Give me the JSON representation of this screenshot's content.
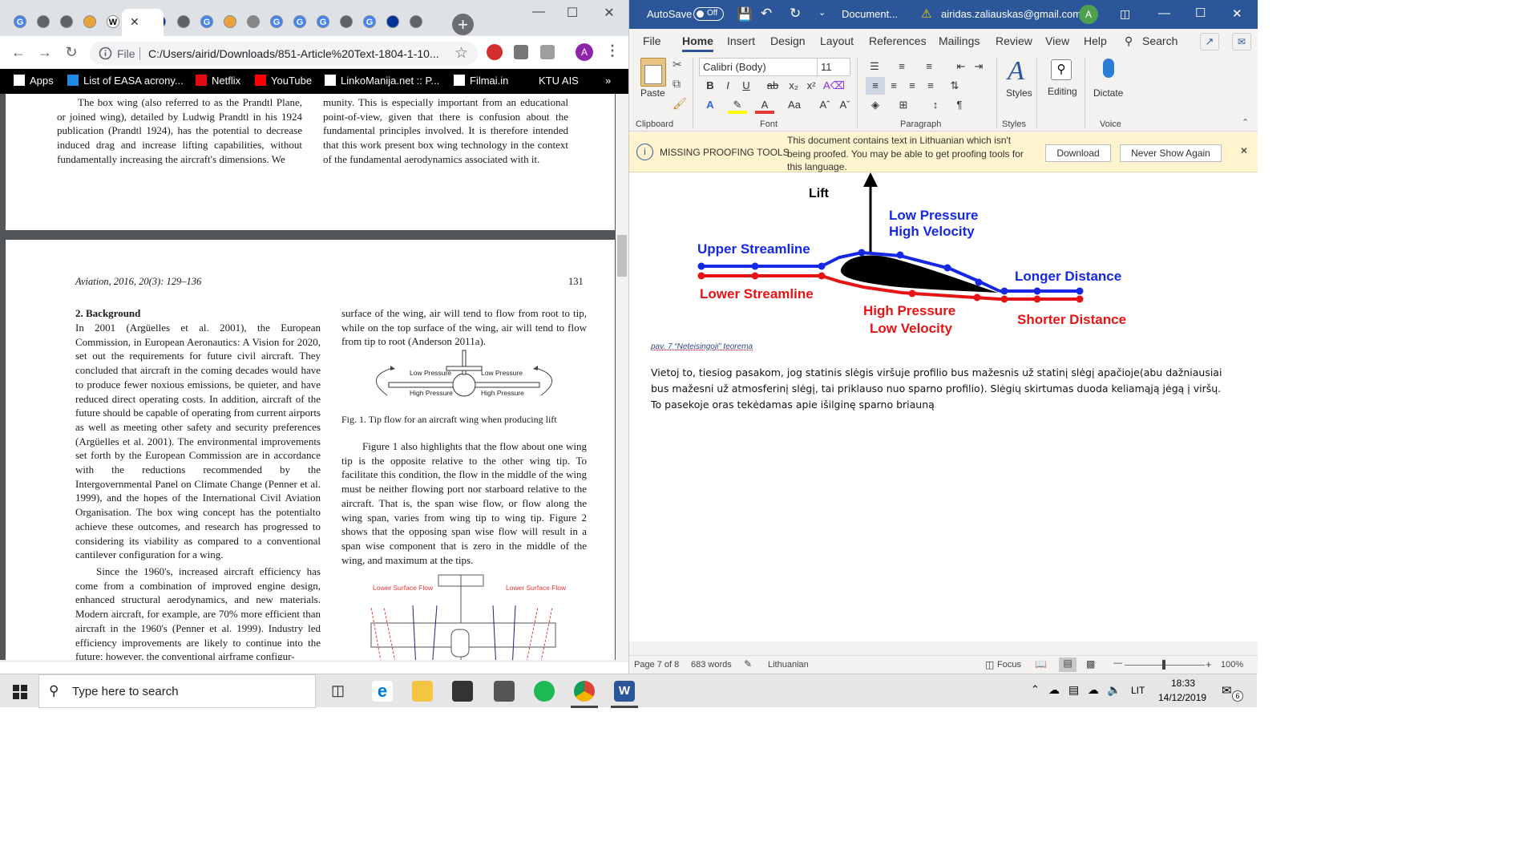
{
  "chrome": {
    "tabs": [
      {
        "icon": "google-icon",
        "color": "#4285f4",
        "glyph": "G"
      },
      {
        "icon": "globe-icon",
        "color": "#5f6368",
        "glyph": ""
      },
      {
        "icon": "globe-icon",
        "color": "#5f6368",
        "glyph": ""
      },
      {
        "icon": "scholar-bars-icon",
        "color": "#e8a33d",
        "glyph": ""
      },
      {
        "icon": "wikipedia-icon",
        "color": "#ffffff",
        "glyph": "W"
      },
      {
        "icon": "eu-flag-icon",
        "color": "#003399",
        "glyph": ""
      },
      {
        "icon": "globe-icon",
        "color": "#5f6368",
        "glyph": ""
      },
      {
        "icon": "google-icon",
        "color": "#4285f4",
        "glyph": "G"
      },
      {
        "icon": "scholar-bars-icon",
        "color": "#e8a33d",
        "glyph": ""
      },
      {
        "icon": "pdf-image-icon",
        "color": "#888888",
        "glyph": ""
      },
      {
        "icon": "google-icon",
        "color": "#4285f4",
        "glyph": "G"
      },
      {
        "icon": "google-icon",
        "color": "#4285f4",
        "glyph": "G"
      },
      {
        "icon": "google-icon",
        "color": "#4285f4",
        "glyph": "G"
      },
      {
        "icon": "globe-icon",
        "color": "#5f6368",
        "glyph": ""
      },
      {
        "icon": "google-icon",
        "color": "#4285f4",
        "glyph": "G"
      },
      {
        "icon": "eu-flag-icon",
        "color": "#003399",
        "glyph": ""
      },
      {
        "icon": "globe-icon",
        "color": "#5f6368",
        "glyph": ""
      }
    ],
    "new_tab": "+",
    "omnibox": {
      "file_label": "File",
      "url": "C:/Users/airid/Downloads/851-Article%20Text-1804-1-10..."
    },
    "profile_initial": "A",
    "bookmarks": [
      {
        "label": "Apps",
        "icon": "apps-grid-icon",
        "color": "#ffffff"
      },
      {
        "label": "List of EASA acrony...",
        "icon": "easa-icon",
        "color": "#1e88e5"
      },
      {
        "label": "Netflix",
        "icon": "netflix-icon",
        "color": "#e50914"
      },
      {
        "label": "YouTube",
        "icon": "youtube-icon",
        "color": "#ff0000"
      },
      {
        "label": "LinkoManija.net :: P...",
        "icon": "linkomanija-icon",
        "color": "#ffffff"
      },
      {
        "label": "Filmai.in",
        "icon": "filmai-icon",
        "color": "#ffffff"
      },
      {
        "label": "KTU AIS",
        "icon": "",
        "color": ""
      }
    ],
    "bookmarks_more": "»"
  },
  "pdf": {
    "top_left_col": "The box wing (also referred to as the Prandtl Plane, or joined wing), detailed by Ludwig Prandtl in his 1924 publication (Prandtl 1924), has the potential to decrease induced drag and increase lifting capabilities, without fundamentally increasing the aircraft's dimensions. We",
    "top_right_col": "munity. This is especially important from an educational point-of-view, given that there is confusion about the fundamental principles involved. It is therefore intended that this work present box wing technology in the context of the fundamental aerodynamics associated with it.",
    "header_left": "Aviation, 2016, 20(3): 129–136",
    "header_right": "131",
    "section_title": "2. Background",
    "left_col_p1": "In 2001 (Argüelles et al. 2001), the European Commission, in European Aeronautics: A Vision for 2020, set out the requirements for future civil aircraft. They concluded that aircraft in the coming decades would have to produce fewer noxious emissions, be quieter, and have reduced direct operating costs. In addition, aircraft of the future should be capable of operating from current airports as well as meeting other safety and security preferences (Argüelles et al. 2001). The environmental improvements set forth by the European Commission are in accordance with the reductions recommended by the Intergovernmental Panel on Climate Change (Penner et al. 1999), and the hopes of the International Civil Aviation Organisation. The box wing concept has the potentialto achieve these outcomes, and research has progressed to considering its viability as compared to a conventional cantilever configuration for a wing.",
    "left_col_p2": "Since the 1960's, increased aircraft efficiency has come from a combination of improved engine design, enhanced structural aerodynamics, and new materials. Modern aircraft, for example, are 70% more efficient than aircraft in the 1960's (Penner et al. 1999). Industry led efficiency improvements are likely to continue into the future; however, the conventional airframe configur-",
    "right_col_p1": "surface of the wing, air will tend to flow from root to tip, while on the top surface of the wing, air will tend to flow from tip to root (Anderson 2011a).",
    "fig1_labels": {
      "low_left": "Low Pressure",
      "low_right": "Low Pressure",
      "high_left": "High Pressure",
      "high_right": "High Pressure"
    },
    "fig1_caption": "Fig. 1. Tip flow for an aircraft wing when producing lift",
    "right_col_p2": "Figure 1 also highlights that the flow about one wing tip is the opposite relative to the other wing tip. To facilitate this condition, the flow in the middle of the wing must be neither flowing port nor starboard relative to the aircraft. That is, the span wise flow, or flow along the wing span, varies from wing tip to wing tip. Figure 2 shows that the opposing span wise flow will result in a span wise component that is zero in the middle of the wing, and maximum at the tips.",
    "fig2_labels": {
      "left": "Lower Surface Flow",
      "right": "Lower Surface Flow"
    }
  },
  "word": {
    "autosave_label": "AutoSave",
    "autosave_state": "Off",
    "doc_title": "Document...",
    "account": "airidas.zaliauskas@gmail.com",
    "account_initial": "A",
    "menu": [
      "File",
      "Home",
      "Insert",
      "Design",
      "Layout",
      "References",
      "Mailings",
      "Review",
      "View",
      "Help"
    ],
    "search_label": "Search",
    "ribbon": {
      "paste": "Paste",
      "font_name": "Calibri (Body)",
      "font_size": "11",
      "styles": "Styles",
      "editing": "Editing",
      "dictate": "Dictate",
      "groups": [
        "Clipboard",
        "Font",
        "Paragraph",
        "Styles",
        "Voice"
      ]
    },
    "infobar": {
      "title": "MISSING PROOFING TOOLS",
      "message": "This document contains text in Lithuanian which isn't being proofed. You may be able to get proofing tools for this language.",
      "download": "Download",
      "never_show": "Never Show Again"
    },
    "figure": {
      "lift": "Lift",
      "low_pressure": "Low Pressure",
      "high_velocity": "High Velocity",
      "upper_streamline": "Upper Streamline",
      "lower_streamline": "Lower Streamline",
      "longer_distance": "Longer Distance",
      "high_pressure": "High Pressure",
      "low_velocity": "Low Velocity",
      "shorter_distance": "Shorter Distance"
    },
    "caption": "pav. 7 “Neteisingoji” teorema",
    "body": "Vietoj to, tiesiog pasakom, jog statinis slėgis viršuje profilio bus mažesnis už statinį slėgį apačioje(abu dažniausiai bus mažesni už atmosferinį slėgį, tai priklauso nuo sparno profilio). Slėgių skirtumas duoda keliamąją jėgą į viršų. To pasekoje oras tekėdamas apie išilginę sparno briauną",
    "status": {
      "page": "Page 7 of 8",
      "words": "683 words",
      "language": "Lithuanian",
      "focus": "Focus",
      "zoom": "100%"
    }
  },
  "taskbar": {
    "search_placeholder": "Type here to search",
    "lang": "LIT",
    "time": "18:33",
    "date": "14/12/2019",
    "notifications": "6"
  },
  "colors": {
    "word_blue": "#2b579a",
    "upper_blue": "#1428e6",
    "lower_red": "#e61414"
  }
}
